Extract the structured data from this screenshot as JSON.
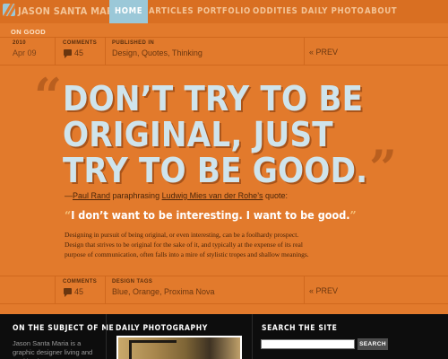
{
  "header": {
    "site_name": "JASON SANTA MARIA",
    "nav": [
      {
        "label": "HOME",
        "active": true
      },
      {
        "label": "ARTICLES",
        "active": false
      },
      {
        "label": "PORTFOLIO",
        "active": false
      },
      {
        "label": "ODDITIES",
        "active": false
      },
      {
        "label": "DAILY PHOTO",
        "active": false
      },
      {
        "label": "ABOUT",
        "active": false
      }
    ]
  },
  "section_label": "ON GOOD",
  "meta_top": {
    "year": "2010",
    "date": "Apr 09",
    "comments_label": "COMMENTS",
    "comments_count": "45",
    "published_label": "PUBLISHED IN",
    "categories": "Design, Quotes, Thinking",
    "prev_label": "« PREV"
  },
  "article": {
    "headline_lines": [
      "DON’T TRY TO BE",
      "ORIGINAL, JUST",
      "TRY TO BE GOOD."
    ],
    "open_quote": "“",
    "close_quote": "”",
    "attribution": {
      "dash": "—",
      "author": "Paul Rand",
      "middle": " paraphrasing ",
      "source": "Ludwig Mies van der Rohe’s",
      "suffix": " quote:"
    },
    "pull_quote": {
      "open": "“",
      "text": "I don’t want to be interesting. I want to be good.",
      "close": "”"
    },
    "paragraph": "Designing in pursuit of being original, or even interesting, can be a foolhardy prospect. Design that strives to be original for the sake of it, and typically at the expense of its real purpose of communication, often falls into a mire of stylistic tropes and shallow meanings."
  },
  "meta_bottom": {
    "comments_label": "COMMENTS",
    "comments_count": "45",
    "tags_label": "DESIGN TAGS",
    "tags": "Blue, Orange, Proxima Nova",
    "prev_label": "« PREV"
  },
  "footer": {
    "about_heading": "ON THE SUBJECT OF ME",
    "about_text": "Jason Santa Maria is a graphic designer living and working in",
    "photo_heading": "DAILY PHOTOGRAPHY",
    "search_heading": "SEARCH THE SITE",
    "search_placeholder": "",
    "search_button": "SEARCH"
  },
  "colors": {
    "background": "#e27a2c",
    "accent_blue": "#9bc8d8",
    "headline": "#cfe4ec",
    "footer": "#0d0d0d"
  }
}
